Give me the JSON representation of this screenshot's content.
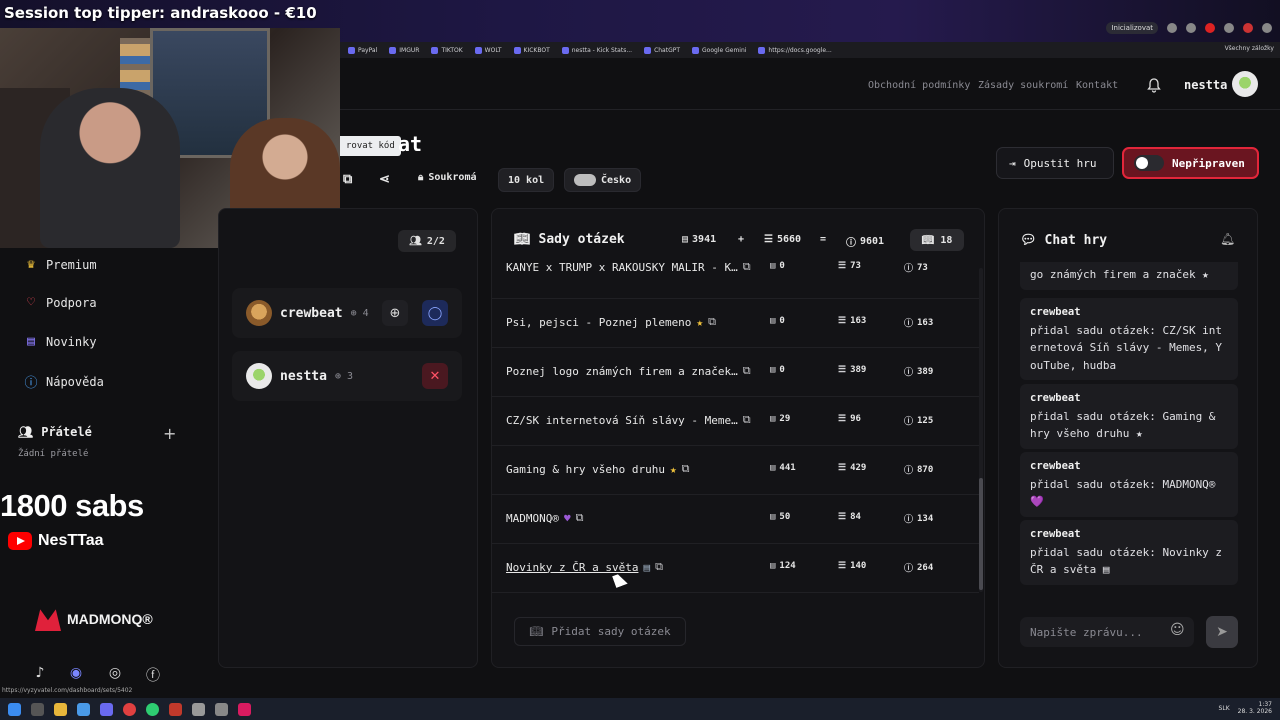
{
  "stream": {
    "tipper": "Session top tipper: andraskooo - €10",
    "subs": "1800 sabs",
    "yt_name": "NesTTaa",
    "madmonq": "MADMONQ®"
  },
  "browser": {
    "bookmarks": [
      "PayPal",
      "IMGUR",
      "TIKTOK",
      "WOLT",
      "KICKBOT",
      "nestta - Kick Stats...",
      "ChatGPT",
      "Google Gemini",
      "https://docs.google..."
    ],
    "all_bookmarks": "Všechny záložky",
    "chip": "Inicializovat",
    "status_url": "https://vyzyvatel.com/dashboard/sets/5402"
  },
  "header": {
    "links": [
      "Obchodní podmínky",
      "Zásady soukromí",
      "Kontakt"
    ],
    "username": "nestta"
  },
  "room": {
    "tooltip": "rovat kód",
    "title_visible": "at",
    "privacy": "Soukromá",
    "rounds": "10 kol",
    "region": "Česko",
    "leave": "Opustit hru",
    "ready": "Nepřipraven"
  },
  "sidebar": {
    "items": [
      {
        "label": "Premium",
        "icon": "crown-icon",
        "glyph": "♛",
        "color": "#f0c23b"
      },
      {
        "label": "Podpora",
        "icon": "heart-icon",
        "glyph": "♡",
        "color": "#ff4d5e"
      },
      {
        "label": "Novinky",
        "icon": "news-icon",
        "glyph": "▤",
        "color": "#8c7bff"
      },
      {
        "label": "Nápověda",
        "icon": "help-icon",
        "glyph": "?",
        "color": "#4fa8ff"
      }
    ],
    "friends_title": "Přátelé",
    "no_friends": "Žádní přátelé"
  },
  "players": {
    "count": "2/2",
    "list": [
      {
        "name": "crewbeat",
        "points": "4"
      },
      {
        "name": "nestta",
        "points": "3"
      }
    ]
  },
  "sets": {
    "title": "Sady otázek",
    "sum_a": "3941",
    "plus": "+",
    "sum_b": "5660",
    "equals": "=",
    "sum_total": "9601",
    "count": "18",
    "rows": [
      {
        "name": "KANYE x TRUMP x RAKOUSKY MALIR - K…",
        "a": "0",
        "b": "73",
        "c": "73",
        "badge": "",
        "underline": false
      },
      {
        "name": "Psi, pejsci - Poznej plemeno",
        "a": "0",
        "b": "163",
        "c": "163",
        "badge": "★",
        "underline": false
      },
      {
        "name": "Poznej logo známých firem a značek…",
        "a": "0",
        "b": "389",
        "c": "389",
        "badge": "",
        "underline": false
      },
      {
        "name": "CZ/SK internetová Síň slávy - Meme…",
        "a": "29",
        "b": "96",
        "c": "125",
        "badge": "",
        "underline": false
      },
      {
        "name": "Gaming & hry všeho druhu",
        "a": "441",
        "b": "429",
        "c": "870",
        "badge": "★",
        "underline": false
      },
      {
        "name": "MADMONQ®",
        "a": "50",
        "b": "84",
        "c": "134",
        "badge": "♥",
        "underline": false
      },
      {
        "name": "Novinky z ČR a světa",
        "a": "124",
        "b": "140",
        "c": "264",
        "badge": "▤",
        "underline": true
      }
    ],
    "add_label": "Přidat sady otázek"
  },
  "chat": {
    "title": "Chat hry",
    "messages": [
      {
        "who": "",
        "text": "go známých firem a značek ★"
      },
      {
        "who": "crewbeat",
        "text": "přidal sadu otázek: CZ/SK int ernetová Síň slávy - Memes, Y ouTube, hudba"
      },
      {
        "who": "crewbeat",
        "text": "přidal sadu otázek: Gaming & hry všeho druhu ★"
      },
      {
        "who": "crewbeat",
        "text": "přidal sadu otázek: MADMONQ® 💜"
      },
      {
        "who": "crewbeat",
        "text": "přidal sadu otázek: Novinky z ČR a světa ▤"
      }
    ],
    "placeholder": "Napište zprávu..."
  },
  "taskbar": {
    "lang": "SLK",
    "time": "1:37",
    "date": "28. 3. 2026"
  },
  "colors": {
    "accent_red": "#e2263a",
    "star": "#f0c23b",
    "heart": "#9b59d6"
  }
}
